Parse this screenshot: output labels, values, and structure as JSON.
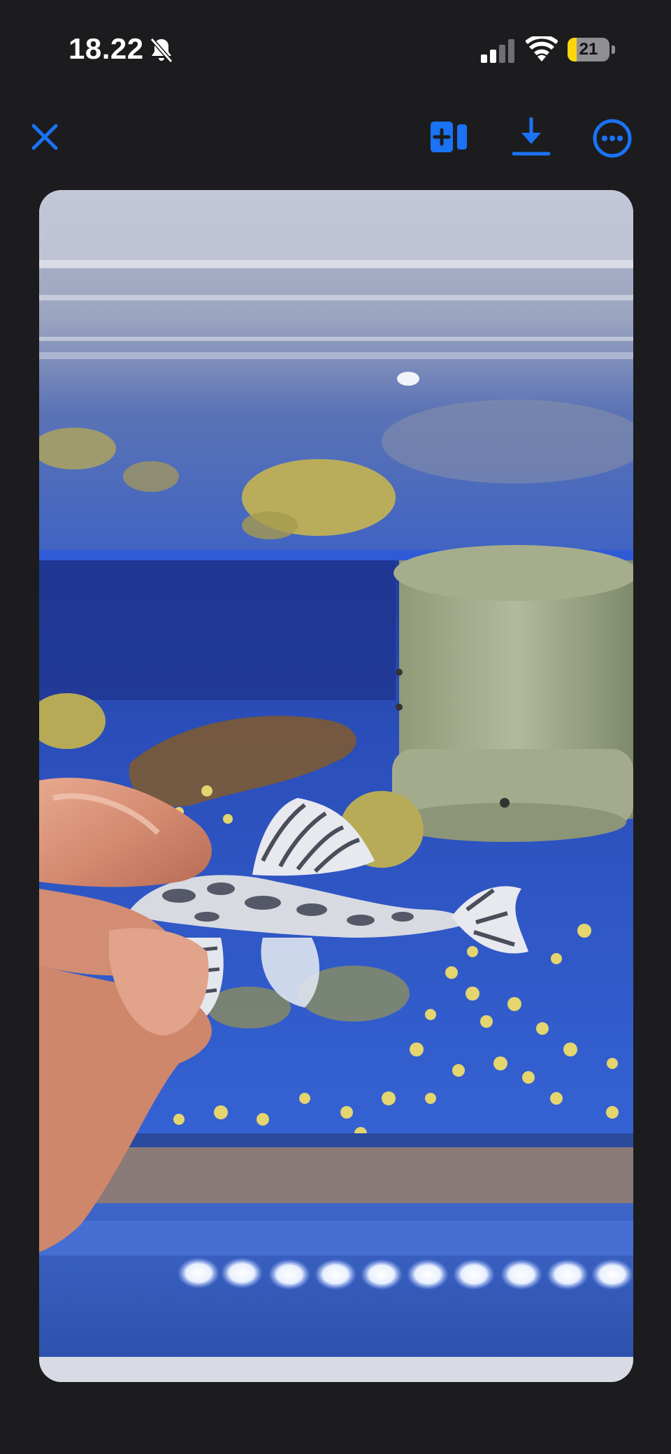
{
  "status_bar": {
    "time": "18.22",
    "battery_level": "21",
    "battery_fraction": 0.21,
    "icons": {
      "silent": "bell-slash-icon",
      "signal": "cellular-signal-icon",
      "wifi": "wifi-icon",
      "battery": "battery-icon"
    }
  },
  "toolbar": {
    "icons": {
      "close": "close-icon",
      "add": "add-to-album-icon",
      "download": "download-icon",
      "more": "more-options-icon"
    },
    "accent_color": "#1a73f5"
  },
  "photo": {
    "subject": "photo-viewer-image",
    "background_color": "#1c1c1e"
  }
}
